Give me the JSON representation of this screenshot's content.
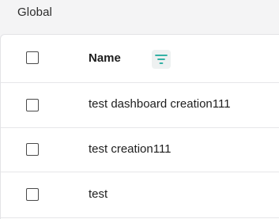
{
  "section": {
    "title": "Global"
  },
  "table": {
    "header": {
      "name_label": "Name"
    },
    "rows": [
      {
        "name": "test dashboard creation111"
      },
      {
        "name": "test creation111"
      },
      {
        "name": "test"
      }
    ]
  },
  "colors": {
    "filter_icon": "#1aa89a",
    "checkbox_border": "#4a4a4a"
  },
  "icons": {
    "filter": "filter-lines-icon"
  }
}
